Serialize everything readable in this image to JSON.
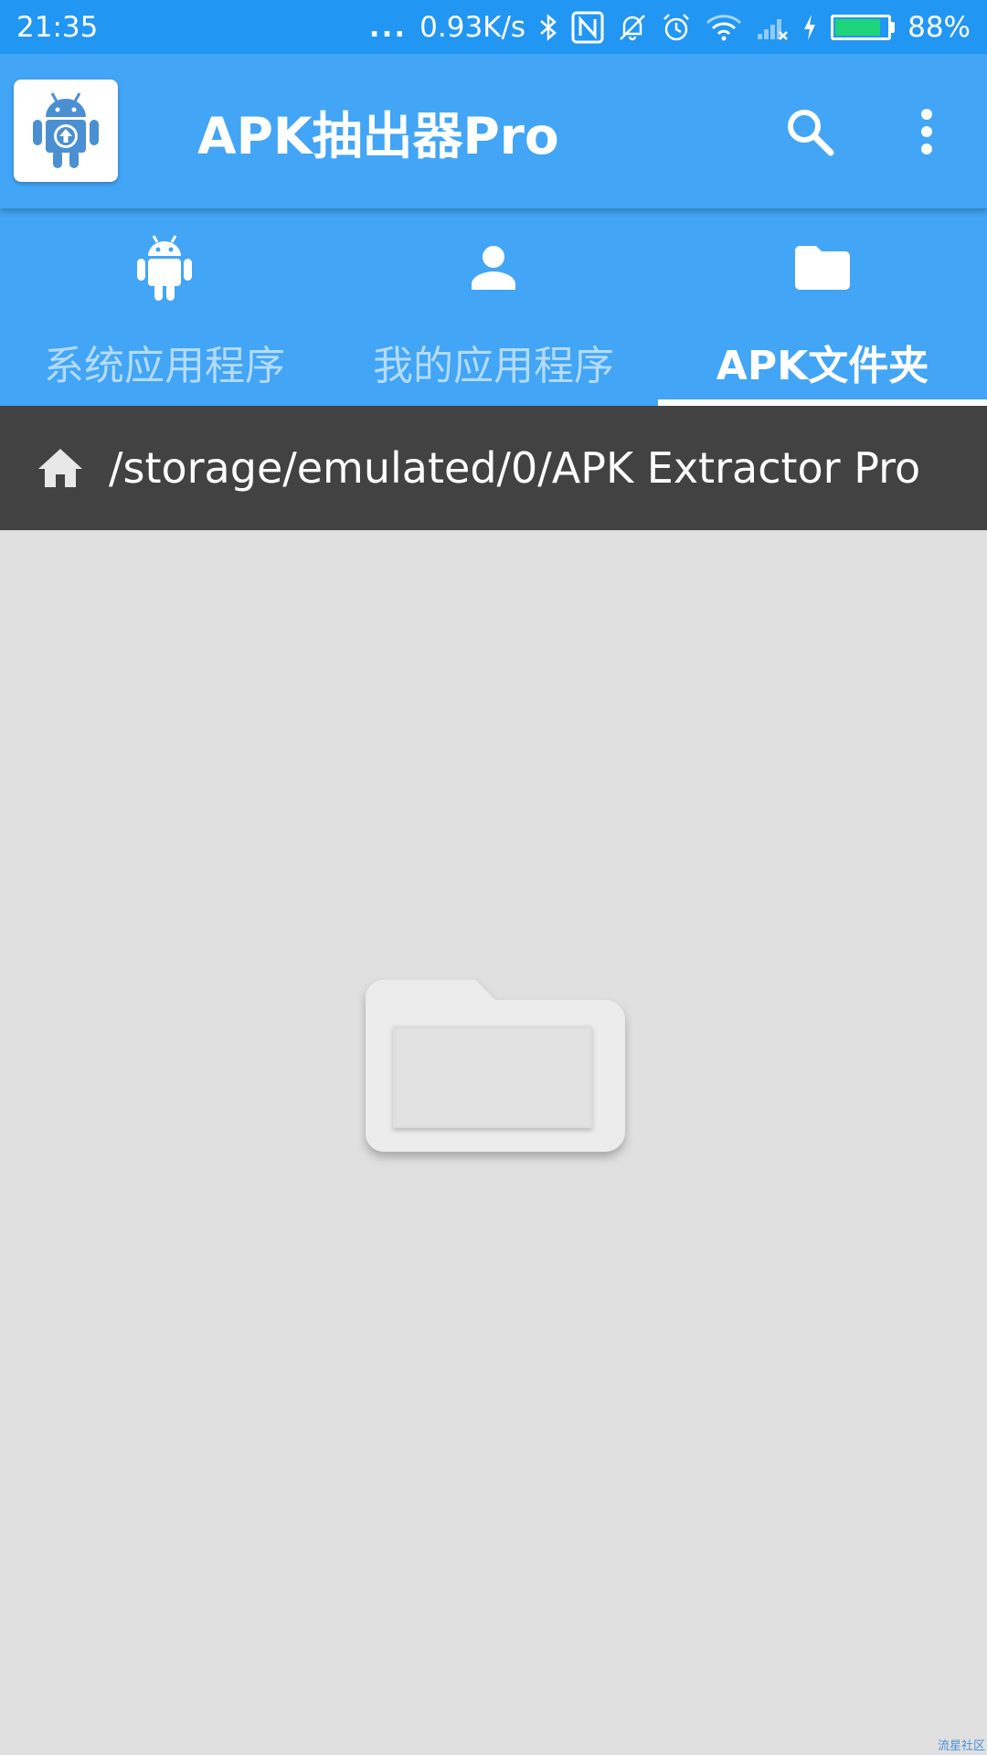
{
  "status_bar": {
    "time": "21:35",
    "dots": "...",
    "net_speed": "0.93K/s",
    "battery_text": "88%",
    "battery_level": 0.88,
    "icons": [
      "bluetooth-icon",
      "nfc-icon",
      "bell-off-icon",
      "alarm-icon",
      "wifi-icon",
      "cell-signal-icon",
      "charging-icon",
      "battery-icon"
    ]
  },
  "app_bar": {
    "title": "APK抽出器Pro",
    "logo_icon": "android-upload-icon",
    "search_icon": "search-icon",
    "menu_icon": "more-vert-icon"
  },
  "tabs": [
    {
      "label": "系统应用程序",
      "icon": "android-icon",
      "active": false
    },
    {
      "label": "我的应用程序",
      "icon": "person-icon",
      "active": false
    },
    {
      "label": "APK文件夹",
      "icon": "folder-icon",
      "active": true
    }
  ],
  "path_bar": {
    "home_icon": "home-icon",
    "path": "/storage/emulated/0/APK Extractor Pro"
  },
  "empty_state": {
    "icon": "empty-folder-icon"
  },
  "watermark": "流星社区",
  "colors": {
    "status_bar": "#2196f3",
    "primary": "#42a5f5",
    "path_bar": "#424242",
    "background": "#e0e0e0",
    "logo_android": "#4a8fd1",
    "battery": "#1ed47a"
  }
}
